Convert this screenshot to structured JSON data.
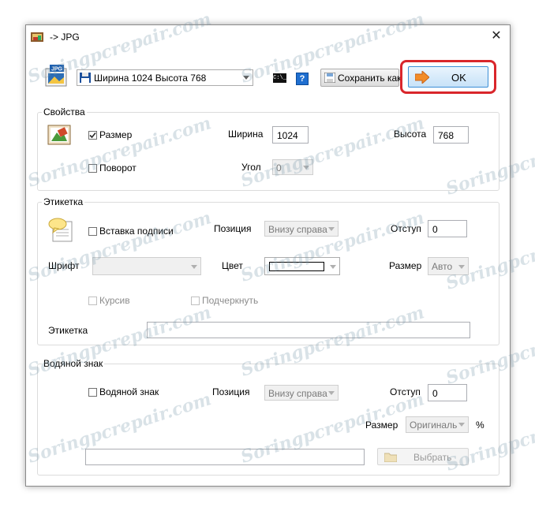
{
  "window": {
    "title": "-> JPG",
    "close_glyph": "✕"
  },
  "toolbar": {
    "format_badge": "JPG",
    "preset_value": "Ширина 1024 Высота 768",
    "cmd_label": "C:\\_",
    "help_label": "?",
    "save_as_label": "Сохранить как",
    "ok_label": "OK"
  },
  "properties": {
    "group_title": "Свойства",
    "size_checkbox_label": "Размер",
    "size_checked": true,
    "width_label": "Ширина",
    "width_value": "1024",
    "height_label": "Высота",
    "height_value": "768",
    "rotate_checkbox_label": "Поворот",
    "rotate_checked": false,
    "angle_label": "Угол",
    "angle_value": "0"
  },
  "label": {
    "group_title": "Этикетка",
    "insert_caption_label": "Вставка подписи",
    "insert_caption_checked": false,
    "position_label": "Позиция",
    "position_value": "Внизу справа",
    "offset_label": "Отступ",
    "offset_value": "0",
    "font_label": "Шрифт",
    "font_value": "",
    "color_label": "Цвет",
    "size_label": "Размер",
    "size_value": "Авто",
    "italic_label": "Курсив",
    "underline_label": "Подчеркнуть",
    "text_label": "Этикетка",
    "text_value": ""
  },
  "watermark": {
    "group_title": "Водяной знак",
    "checkbox_label": "Водяной знак",
    "checked": false,
    "position_label": "Позиция",
    "position_value": "Внизу справа",
    "offset_label": "Отступ",
    "offset_value": "0",
    "size_label": "Размер",
    "size_value": "Оригиналь",
    "percent": "%",
    "path_value": "",
    "browse_label": "Выбрать"
  },
  "site_watermark": "Soringpcrepair.com",
  "colors": {
    "ok_highlight": "#d9262b",
    "ok_button_top": "#e9f4fd",
    "ok_button_bottom": "#c7e2f8",
    "ok_button_border": "#3c8fd6"
  }
}
